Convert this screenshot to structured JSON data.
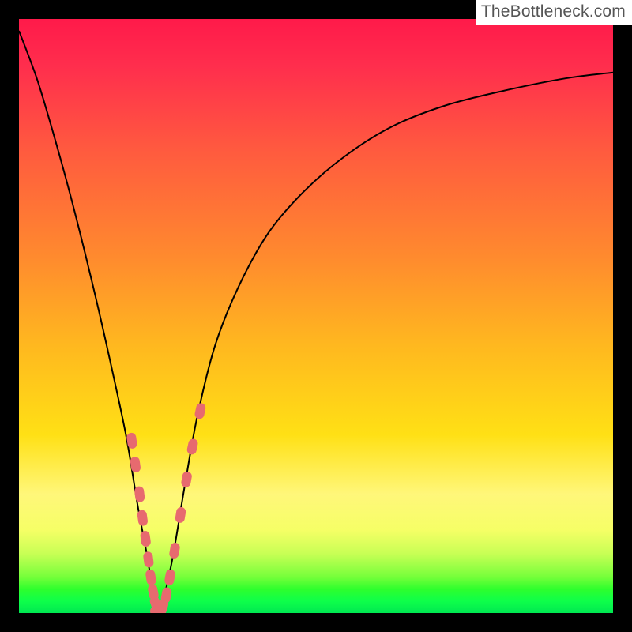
{
  "watermark": "TheBottleneck.com",
  "chart_data": {
    "type": "line",
    "title": "",
    "xlabel": "",
    "ylabel": "",
    "xlim": [
      0,
      100
    ],
    "ylim": [
      0,
      100
    ],
    "grid": false,
    "legend": false,
    "background_gradient": {
      "direction": "vertical",
      "stops": [
        {
          "pos": 0.0,
          "color": "#ff1a4a"
        },
        {
          "pos": 0.45,
          "color": "#ff8a2e"
        },
        {
          "pos": 0.75,
          "color": "#ffe015"
        },
        {
          "pos": 0.92,
          "color": "#c8ff55"
        },
        {
          "pos": 1.0,
          "color": "#00e851"
        }
      ]
    },
    "series": [
      {
        "name": "bottleneck-curve",
        "color": "#000000",
        "x": [
          0.0,
          3.0,
          6.0,
          9.0,
          12.0,
          15.0,
          18.0,
          20.0,
          21.5,
          22.5,
          23.5,
          24.5,
          26.0,
          28.0,
          30.0,
          33.0,
          37.0,
          42.0,
          48.0,
          55.0,
          63.0,
          72.0,
          82.0,
          92.0,
          100.0
        ],
        "y": [
          98.0,
          90.0,
          80.0,
          69.0,
          57.0,
          44.0,
          30.0,
          18.0,
          10.0,
          4.0,
          0.0,
          3.0,
          10.0,
          22.0,
          33.0,
          45.0,
          55.0,
          64.0,
          71.0,
          77.0,
          82.0,
          85.5,
          88.0,
          90.0,
          91.0
        ]
      }
    ],
    "annotations": {
      "bead_cluster": {
        "note": "highlighted data points around curve minimum",
        "color": "#e76a6f",
        "points_xy": [
          [
            19.0,
            29.0
          ],
          [
            19.6,
            25.0
          ],
          [
            20.3,
            20.0
          ],
          [
            20.8,
            16.0
          ],
          [
            21.3,
            12.5
          ],
          [
            21.8,
            9.0
          ],
          [
            22.2,
            6.0
          ],
          [
            22.6,
            3.5
          ],
          [
            23.0,
            1.5
          ],
          [
            23.4,
            0.3
          ],
          [
            23.8,
            0.3
          ],
          [
            24.2,
            1.0
          ],
          [
            24.8,
            3.0
          ],
          [
            25.4,
            6.0
          ],
          [
            26.2,
            10.5
          ],
          [
            27.2,
            16.5
          ],
          [
            28.2,
            22.5
          ],
          [
            29.2,
            28.0
          ],
          [
            30.5,
            34.0
          ]
        ]
      }
    }
  }
}
